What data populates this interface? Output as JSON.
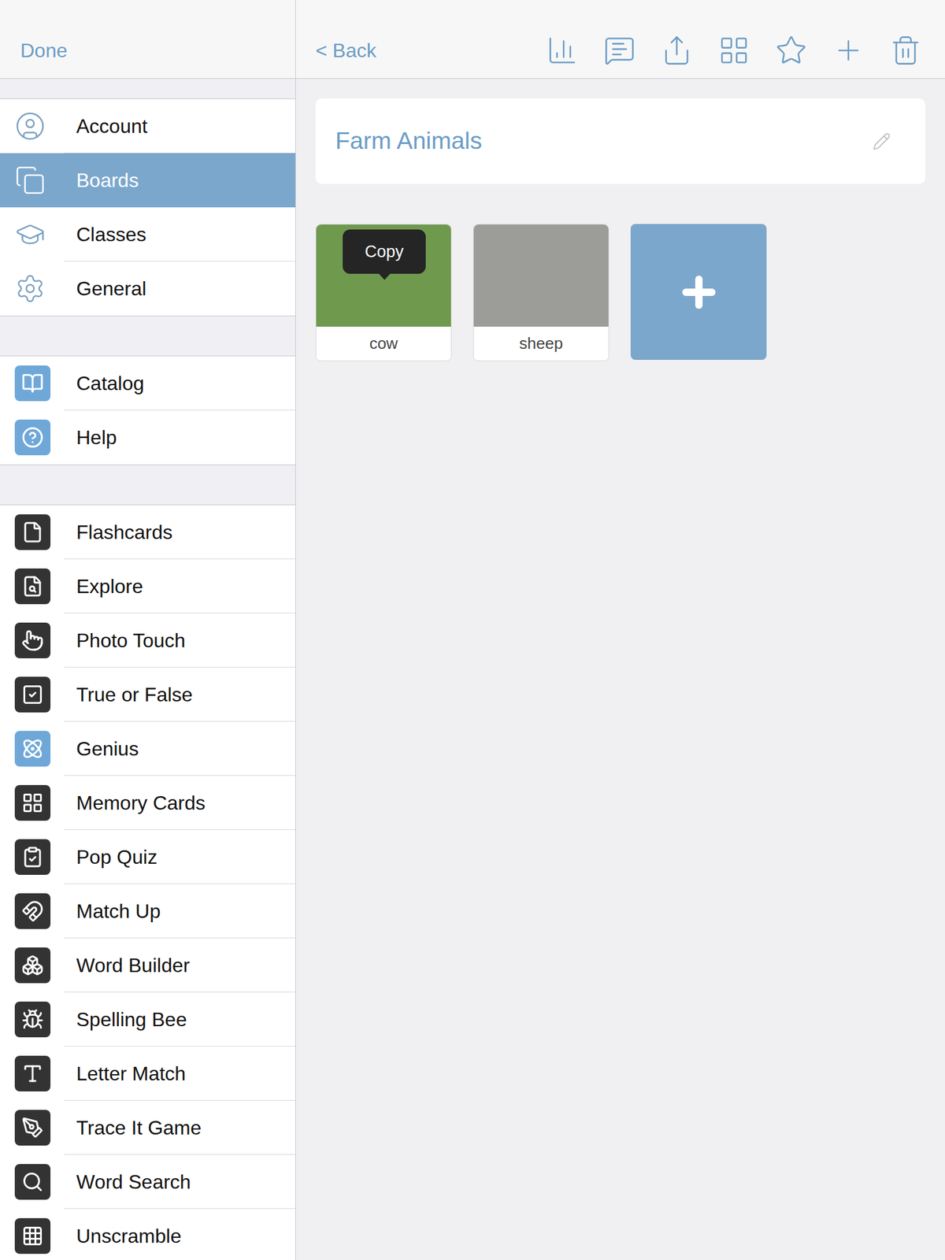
{
  "header": {
    "done": "Done",
    "back": "< Back"
  },
  "sidebar": {
    "groups": [
      {
        "items": [
          {
            "label": "Account",
            "kind": "setting",
            "selected": false
          },
          {
            "label": "Boards",
            "kind": "setting",
            "selected": true
          },
          {
            "label": "Classes",
            "kind": "setting",
            "selected": false
          },
          {
            "label": "General",
            "kind": "setting",
            "selected": false
          }
        ]
      },
      {
        "items": [
          {
            "label": "Catalog",
            "kind": "link",
            "selected": false
          },
          {
            "label": "Help",
            "kind": "link",
            "selected": false
          }
        ]
      },
      {
        "items": [
          {
            "label": "Flashcards",
            "kind": "app",
            "selected": false,
            "color": "#333333"
          },
          {
            "label": "Explore",
            "kind": "app",
            "selected": false,
            "color": "#333333"
          },
          {
            "label": "Photo Touch",
            "kind": "app",
            "selected": false,
            "color": "#333333"
          },
          {
            "label": "True or False",
            "kind": "app",
            "selected": false,
            "color": "#333333"
          },
          {
            "label": "Genius",
            "kind": "app",
            "selected": false,
            "color": "#6fa8d8"
          },
          {
            "label": "Memory Cards",
            "kind": "app",
            "selected": false,
            "color": "#333333"
          },
          {
            "label": "Pop Quiz",
            "kind": "app",
            "selected": false,
            "color": "#333333"
          },
          {
            "label": "Match Up",
            "kind": "app",
            "selected": false,
            "color": "#333333"
          },
          {
            "label": "Word Builder",
            "kind": "app",
            "selected": false,
            "color": "#333333"
          },
          {
            "label": "Spelling Bee",
            "kind": "app",
            "selected": false,
            "color": "#333333"
          },
          {
            "label": "Letter Match",
            "kind": "app",
            "selected": false,
            "color": "#333333"
          },
          {
            "label": "Trace It Game",
            "kind": "app",
            "selected": false,
            "color": "#333333"
          },
          {
            "label": "Word Search",
            "kind": "app",
            "selected": false,
            "color": "#333333"
          },
          {
            "label": "Unscramble",
            "kind": "app",
            "selected": false,
            "color": "#333333"
          }
        ]
      }
    ]
  },
  "board": {
    "title": "Farm Animals",
    "cards": [
      {
        "label": "cow",
        "color": "#6f9a4e",
        "tooltip": "Copy"
      },
      {
        "label": "sheep",
        "color": "#9c9c98"
      }
    ]
  }
}
